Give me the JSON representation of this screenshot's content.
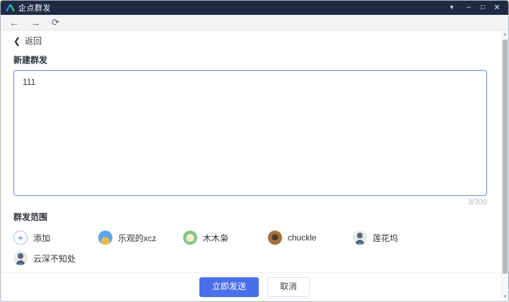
{
  "window": {
    "title": "企点群发",
    "controls": {
      "menu": "▼",
      "minimize": "–",
      "maximize": "□",
      "close": "✕"
    }
  },
  "nav": {
    "back_icon": "←",
    "forward_icon": "→",
    "refresh_icon": "⟳"
  },
  "page": {
    "back_chevron": "❮",
    "back_label": "返回",
    "title": "新建群发",
    "message": {
      "value": "111",
      "counter": "3/300",
      "max_length": "300"
    },
    "scope": {
      "title": "群发范围",
      "add_icon": "+",
      "add_label": "添加",
      "contacts": [
        {
          "name": "乐观的xcz"
        },
        {
          "name": "木木枭"
        },
        {
          "name": "chuckle"
        },
        {
          "name": "莲花坞"
        },
        {
          "name": "云深不知处"
        }
      ]
    },
    "actions": {
      "send": "立即发送",
      "cancel": "取消"
    }
  },
  "colors": {
    "titlebar": "#1f2b45",
    "accent": "#4a6fe8",
    "textarea_border": "#6e87ee",
    "navbar": "#f1f3f5"
  }
}
